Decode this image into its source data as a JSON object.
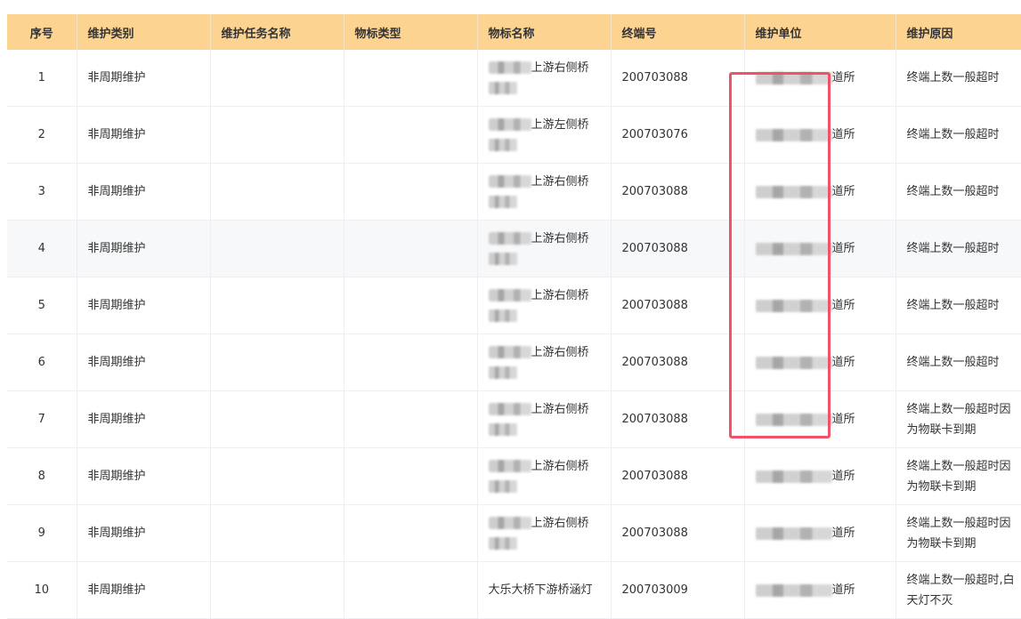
{
  "table": {
    "headers": [
      "序号",
      "维护类别",
      "维护任务名称",
      "物标类型",
      "物标名称",
      "终端号",
      "维护单位",
      "维护原因"
    ],
    "rows": [
      {
        "index": "1",
        "category": "非周期维护",
        "task_name": "",
        "target_type": "",
        "target_name": "上游右侧桥",
        "terminal": "200703088",
        "unit": "道所",
        "reason": "终端上数一般超时"
      },
      {
        "index": "2",
        "category": "非周期维护",
        "task_name": "",
        "target_type": "",
        "target_name": "上游左侧桥",
        "terminal": "200703076",
        "unit": "道所",
        "reason": "终端上数一般超时"
      },
      {
        "index": "3",
        "category": "非周期维护",
        "task_name": "",
        "target_type": "",
        "target_name": "上游右侧桥",
        "terminal": "200703088",
        "unit": "道所",
        "reason": "终端上数一般超时"
      },
      {
        "index": "4",
        "category": "非周期维护",
        "task_name": "",
        "target_type": "",
        "target_name": "上游右侧桥",
        "terminal": "200703088",
        "unit": "道所",
        "reason": "终端上数一般超时"
      },
      {
        "index": "5",
        "category": "非周期维护",
        "task_name": "",
        "target_type": "",
        "target_name": "上游右侧桥",
        "terminal": "200703088",
        "unit": "道所",
        "reason": "终端上数一般超时"
      },
      {
        "index": "6",
        "category": "非周期维护",
        "task_name": "",
        "target_type": "",
        "target_name": "上游右侧桥",
        "terminal": "200703088",
        "unit": "道所",
        "reason": "终端上数一般超时"
      },
      {
        "index": "7",
        "category": "非周期维护",
        "task_name": "",
        "target_type": "",
        "target_name": "上游右侧桥",
        "terminal": "200703088",
        "unit": "道所",
        "reason": "终端上数一般超时因为物联卡到期"
      },
      {
        "index": "8",
        "category": "非周期维护",
        "task_name": "",
        "target_type": "",
        "target_name": "上游右侧桥",
        "terminal": "200703088",
        "unit": "道所",
        "reason": "终端上数一般超时因为物联卡到期"
      },
      {
        "index": "9",
        "category": "非周期维护",
        "task_name": "",
        "target_type": "",
        "target_name": "上游右侧桥",
        "terminal": "200703088",
        "unit": "道所",
        "reason": "终端上数一般超时因为物联卡到期"
      },
      {
        "index": "10",
        "category": "非周期维护",
        "task_name": "",
        "target_type": "",
        "target_name": "大乐大桥下游桥涵灯",
        "terminal": "200703009",
        "unit": "道所",
        "reason": "终端上数一般超时,白天灯不灭"
      }
    ]
  },
  "colors": {
    "header_bg": "#fcd391",
    "highlight_border": "#ee5368",
    "stripe_bg": "#f7f8fa"
  }
}
